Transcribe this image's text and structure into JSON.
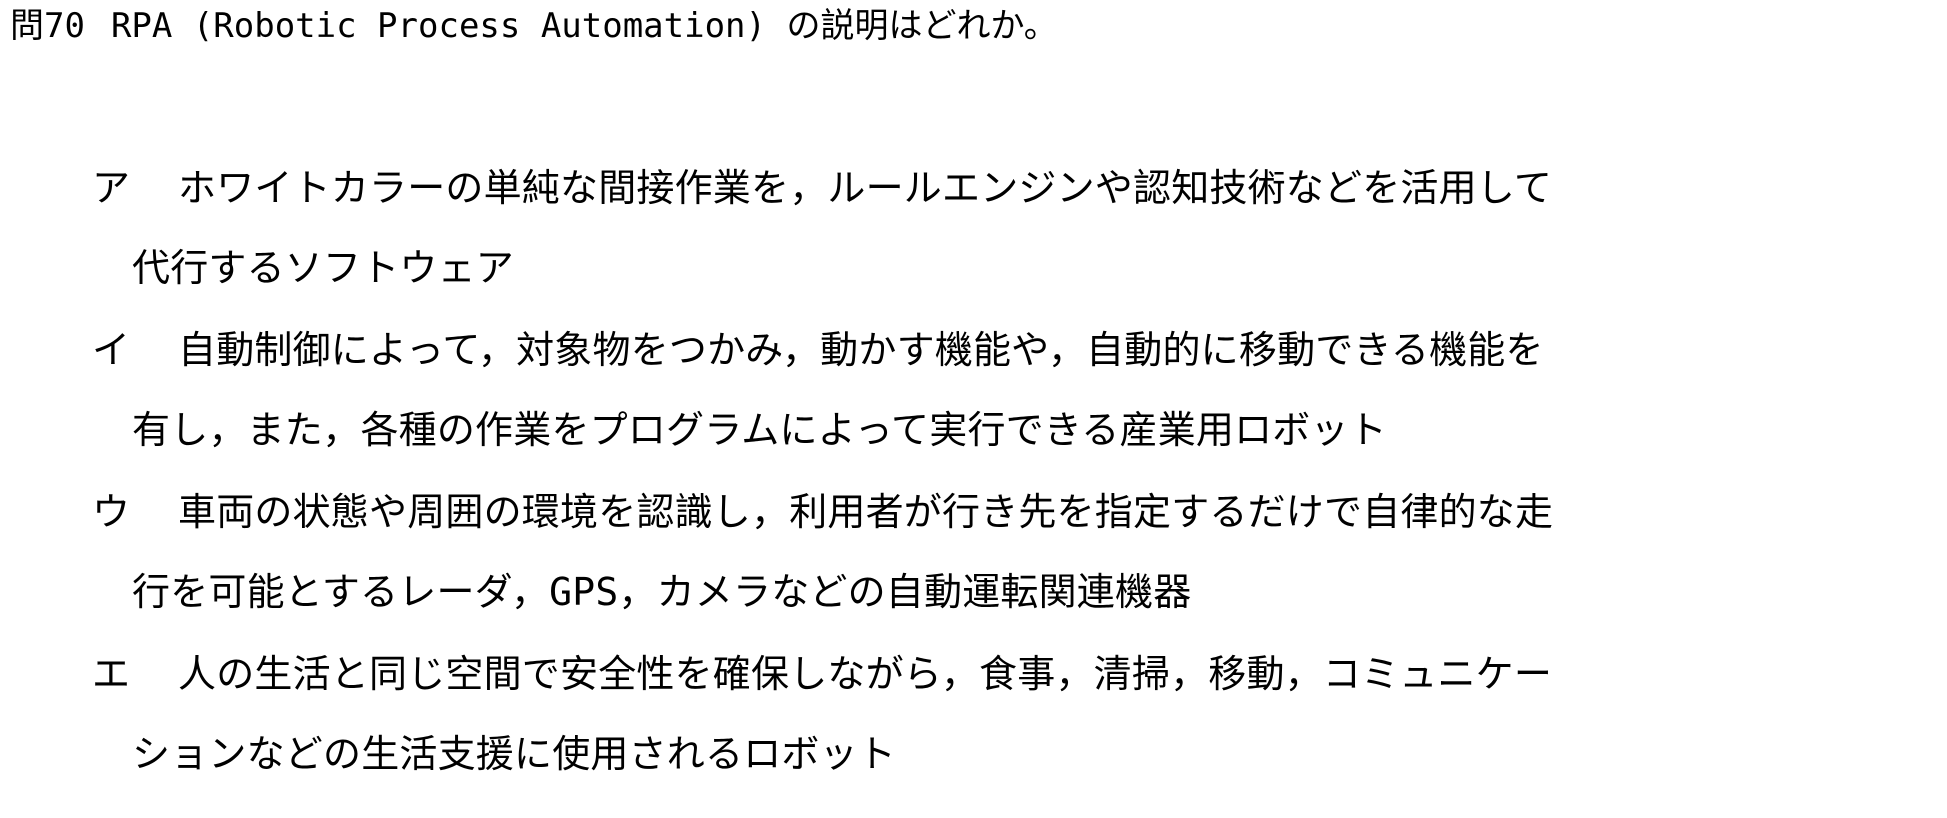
{
  "question": {
    "number": "問70",
    "text": "RPA (Robotic Process Automation) の説明はどれか。"
  },
  "choices": [
    {
      "marker": "ア",
      "line1": "ホワイトカラーの単純な間接作業を，ルールエンジンや認知技術などを活用して",
      "line2": "代行するソフトウェア"
    },
    {
      "marker": "イ",
      "line1": "自動制御によって，対象物をつかみ，動かす機能や，自動的に移動できる機能を",
      "line2": "有し，また，各種の作業をプログラムによって実行できる産業用ロボット"
    },
    {
      "marker": "ウ",
      "line1": "車両の状態や周囲の環境を認識し，利用者が行き先を指定するだけで自律的な走",
      "line2": "行を可能とするレーダ，GPS，カメラなどの自動運転関連機器"
    },
    {
      "marker": "エ",
      "line1": "人の生活と同じ空間で安全性を確保しながら，食事，清掃，移動，コミュニケー",
      "line2": "ションなどの生活支援に使用されるロボット"
    }
  ]
}
